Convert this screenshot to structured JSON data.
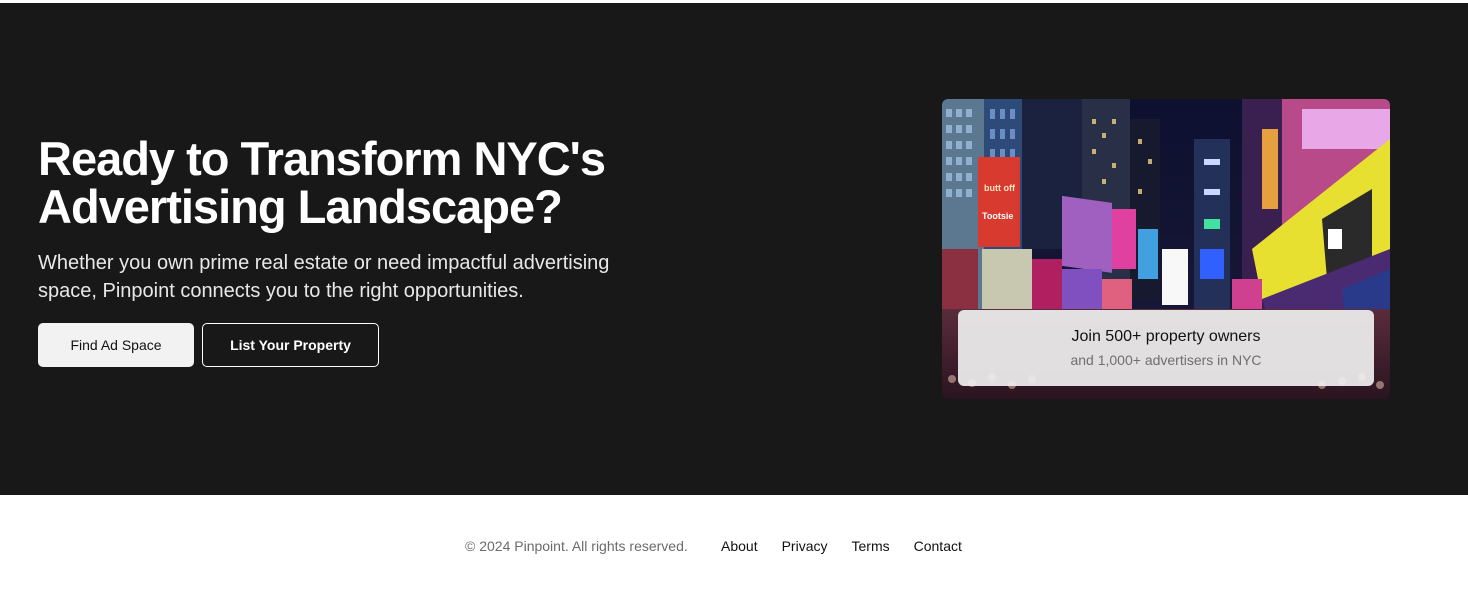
{
  "hero": {
    "headline_line1": "Ready to Transform NYC's",
    "headline_line2": "Advertising Landscape?",
    "subtext": "Whether you own prime real estate or need impactful advertising space, Pinpoint connects you to the right opportunities.",
    "primary_button": "Find Ad Space",
    "secondary_button": "List Your Property"
  },
  "image_card": {
    "stat_title": "Join 500+ property owners",
    "stat_subtitle": "and 1,000+ advertisers in NYC",
    "billboard_text_1": "butt off",
    "billboard_text_2": "Tootsie"
  },
  "footer": {
    "copyright": "© 2024 Pinpoint. All rights reserved.",
    "links": [
      "About",
      "Privacy",
      "Terms",
      "Contact"
    ]
  },
  "colors": {
    "hero_background": "#181818",
    "footer_background": "#ffffff",
    "primary_button": "#f2f2f2"
  }
}
